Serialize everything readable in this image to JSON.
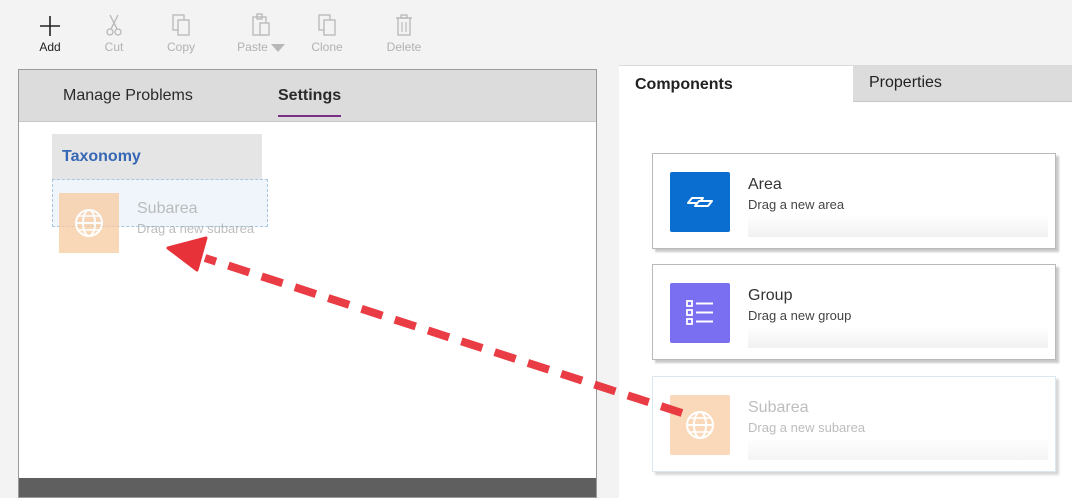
{
  "toolbar": {
    "add_label": "Add",
    "cut_label": "Cut",
    "copy_label": "Copy",
    "paste_label": "Paste",
    "clone_label": "Clone",
    "delete_label": "Delete"
  },
  "left_panel": {
    "tabs": [
      {
        "label": "Manage Problems",
        "active": false
      },
      {
        "label": "Settings",
        "active": true
      }
    ],
    "taxonomy_label": "Taxonomy",
    "dragged_item": {
      "title": "Subarea",
      "subtitle": "Drag a new subarea",
      "icon": "globe-icon"
    }
  },
  "right_panel": {
    "tabs": [
      {
        "label": "Components",
        "active": true
      },
      {
        "label": "Properties",
        "active": false
      }
    ],
    "components": [
      {
        "title": "Area",
        "subtitle": "Drag a new area",
        "icon": "area-icon",
        "color": "#0a6ed1"
      },
      {
        "title": "Group",
        "subtitle": "Drag a new group",
        "icon": "group-list-icon",
        "color": "#7b6ff1"
      },
      {
        "title": "Subarea",
        "subtitle": "Drag a new subarea",
        "icon": "globe-icon",
        "color": "#f8cba0"
      }
    ]
  },
  "colors": {
    "accent_tab_underline": "#7a2f86",
    "taxonomy_text": "#3667b4",
    "arrow": "#e8323a"
  }
}
